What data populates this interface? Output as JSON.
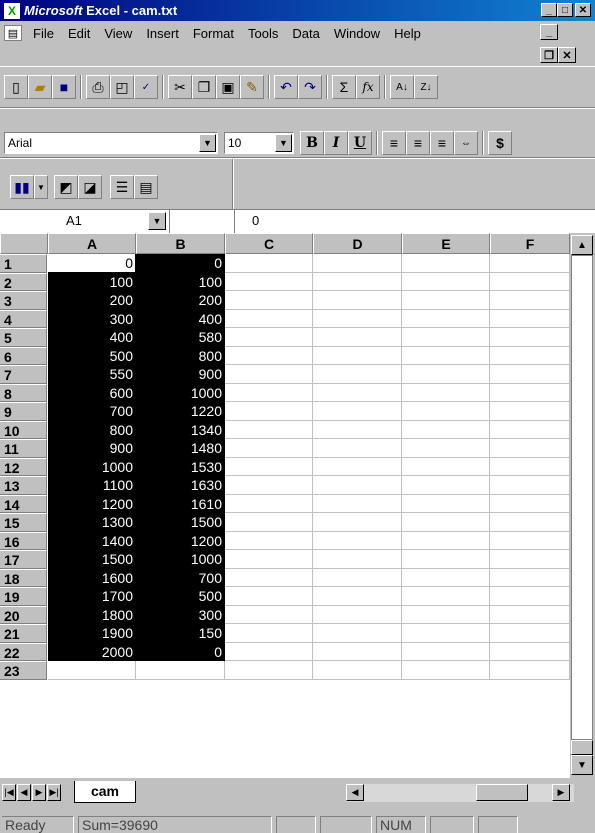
{
  "window": {
    "app_name": "Microsoft",
    "title_rest": " Excel - cam.txt",
    "minimize": "_",
    "maximize": "□",
    "close": "✕"
  },
  "menu": {
    "items": [
      "File",
      "Edit",
      "View",
      "Insert",
      "Format",
      "Tools",
      "Data",
      "Window",
      "Help"
    ]
  },
  "format": {
    "font": "Arial",
    "size": "10"
  },
  "name_box": "A1",
  "formula_value": "0",
  "columns": [
    "A",
    "B",
    "C",
    "D",
    "E",
    "F"
  ],
  "rows": [
    {
      "n": "1",
      "a": "0",
      "b": "0"
    },
    {
      "n": "2",
      "a": "100",
      "b": "100"
    },
    {
      "n": "3",
      "a": "200",
      "b": "200"
    },
    {
      "n": "4",
      "a": "300",
      "b": "400"
    },
    {
      "n": "5",
      "a": "400",
      "b": "580"
    },
    {
      "n": "6",
      "a": "500",
      "b": "800"
    },
    {
      "n": "7",
      "a": "550",
      "b": "900"
    },
    {
      "n": "8",
      "a": "600",
      "b": "1000"
    },
    {
      "n": "9",
      "a": "700",
      "b": "1220"
    },
    {
      "n": "10",
      "a": "800",
      "b": "1340"
    },
    {
      "n": "11",
      "a": "900",
      "b": "1480"
    },
    {
      "n": "12",
      "a": "1000",
      "b": "1530"
    },
    {
      "n": "13",
      "a": "1100",
      "b": "1630"
    },
    {
      "n": "14",
      "a": "1200",
      "b": "1610"
    },
    {
      "n": "15",
      "a": "1300",
      "b": "1500"
    },
    {
      "n": "16",
      "a": "1400",
      "b": "1200"
    },
    {
      "n": "17",
      "a": "1500",
      "b": "1000"
    },
    {
      "n": "18",
      "a": "1600",
      "b": "700"
    },
    {
      "n": "19",
      "a": "1700",
      "b": "500"
    },
    {
      "n": "20",
      "a": "1800",
      "b": "300"
    },
    {
      "n": "21",
      "a": "1900",
      "b": "150"
    },
    {
      "n": "22",
      "a": "2000",
      "b": "0"
    },
    {
      "n": "23",
      "a": "",
      "b": ""
    }
  ],
  "sheet_tab": "cam",
  "status": {
    "ready": "Ready",
    "sum": "Sum=39690",
    "num": "NUM"
  }
}
